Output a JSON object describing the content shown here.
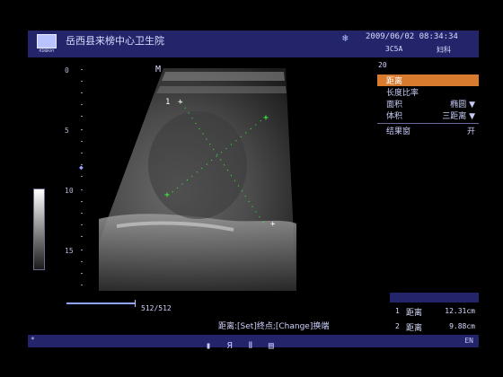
{
  "header": {
    "hospital": "岳西县来榜中心卫生院",
    "datetime": "2009/06/02  08:34:34",
    "probe": "3C5A",
    "exam": "妇科",
    "logo_text": "MINDRAY",
    "freeze_icon": "snowflake-icon"
  },
  "image": {
    "mode": "M",
    "depth_ticks": [
      "0",
      "5",
      "10",
      "15"
    ],
    "frame_counter": "512/512"
  },
  "menu": {
    "number": "20",
    "items": [
      {
        "label": "距离",
        "value": ""
      },
      {
        "label": "长度比率",
        "value": ""
      },
      {
        "label": "面积",
        "value": "椭圆 ▼"
      },
      {
        "label": "体积",
        "value": "三距离 ▼"
      },
      {
        "label": "结果窗",
        "value": "开"
      }
    ],
    "active_index": 0
  },
  "results": {
    "rows": [
      {
        "num": "1",
        "label": "距离",
        "value": "12.31cm"
      },
      {
        "num": "2",
        "label": "距离",
        "value": "9.88cm"
      }
    ]
  },
  "hint": "距离:[Set]终点;[Change]换端",
  "bottombar": {
    "icons": [
      "cursor-icon",
      "gain-icon",
      "zoom-icon",
      "print-icon"
    ],
    "lang": "EN"
  },
  "colors": {
    "bar_blue": "#24246a",
    "menu_active": "#d97b2e",
    "marker_green": "#38ff38"
  }
}
